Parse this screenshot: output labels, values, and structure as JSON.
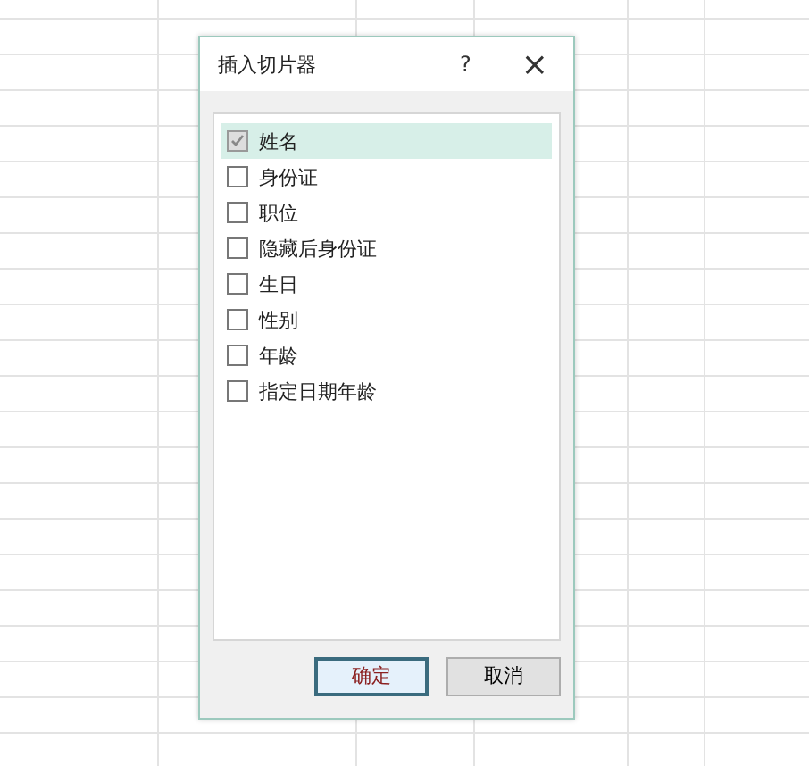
{
  "dialog": {
    "title": "插入切片器",
    "help_button": "?",
    "close_button": "×",
    "fields": [
      {
        "label": "姓名",
        "checked": true,
        "selected": true
      },
      {
        "label": "身份证",
        "checked": false,
        "selected": false
      },
      {
        "label": "职位",
        "checked": false,
        "selected": false
      },
      {
        "label": "隐藏后身份证",
        "checked": false,
        "selected": false
      },
      {
        "label": "生日",
        "checked": false,
        "selected": false
      },
      {
        "label": "性别",
        "checked": false,
        "selected": false
      },
      {
        "label": "年龄",
        "checked": false,
        "selected": false
      },
      {
        "label": "指定日期年龄",
        "checked": false,
        "selected": false
      }
    ],
    "buttons": [
      {
        "label": "确定",
        "kind": "default"
      },
      {
        "label": "取消",
        "kind": "normal"
      }
    ]
  }
}
